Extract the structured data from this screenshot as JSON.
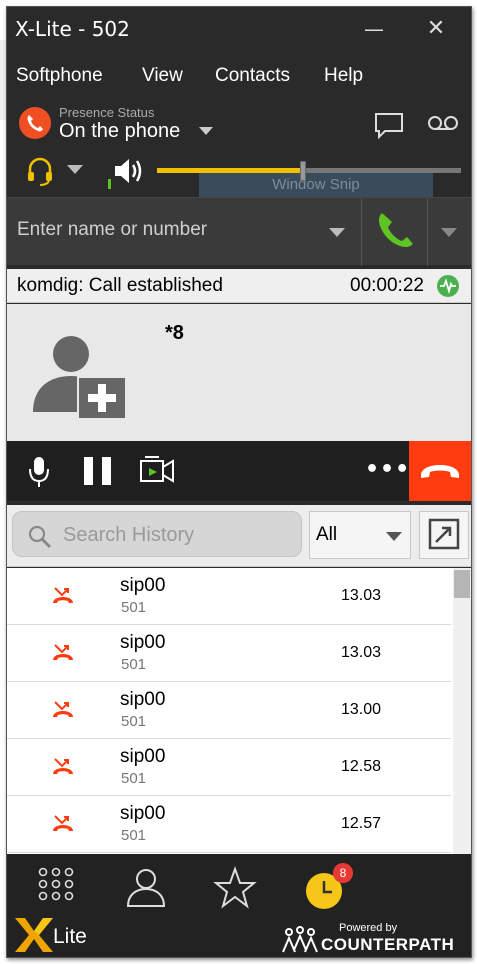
{
  "window": {
    "title": "X-Lite - 502",
    "minimize_glyph": "—",
    "close_glyph": "✕"
  },
  "menu": [
    "Softphone",
    "View",
    "Contacts",
    "Help"
  ],
  "presence": {
    "label": "Presence Status",
    "value": "On the phone"
  },
  "audio": {
    "speaker_volume": 0.48
  },
  "background_window": {
    "title": "Window Snip"
  },
  "dial": {
    "placeholder": "Enter name or number"
  },
  "call": {
    "status": "komdig: Call established",
    "duration": "00:00:22",
    "caller": "*8"
  },
  "controls": {
    "more_label": "•••"
  },
  "history": {
    "search_placeholder": "Search History",
    "filter": "All",
    "items": [
      {
        "name": "sip00",
        "number": "501",
        "time": "13.03"
      },
      {
        "name": "sip00",
        "number": "501",
        "time": "13.03"
      },
      {
        "name": "sip00",
        "number": "501",
        "time": "13.00"
      },
      {
        "name": "sip00",
        "number": "501",
        "time": "12.58"
      },
      {
        "name": "sip00",
        "number": "501",
        "time": "12.57"
      }
    ]
  },
  "bottom_nav": {
    "history_badge": "8"
  },
  "branding": {
    "product": "Lite",
    "powered_by": "Powered by",
    "company": "COUNTERPATH"
  },
  "icons": [
    "phone-icon",
    "chat-icon",
    "voicemail-icon",
    "headset-icon",
    "speaker-icon",
    "mic-icon",
    "pause-icon",
    "video-icon",
    "hangup-icon",
    "search-icon",
    "popout-icon",
    "missed-call-icon",
    "dialpad-icon",
    "contacts-icon",
    "favorites-icon",
    "history-icon"
  ],
  "colors": {
    "accent_orange": "#f04e23",
    "call_green": "#5ec423",
    "hangup_red": "#ff3b10",
    "volume_yellow": "#f0c000",
    "history_yellow": "#f5c518"
  }
}
